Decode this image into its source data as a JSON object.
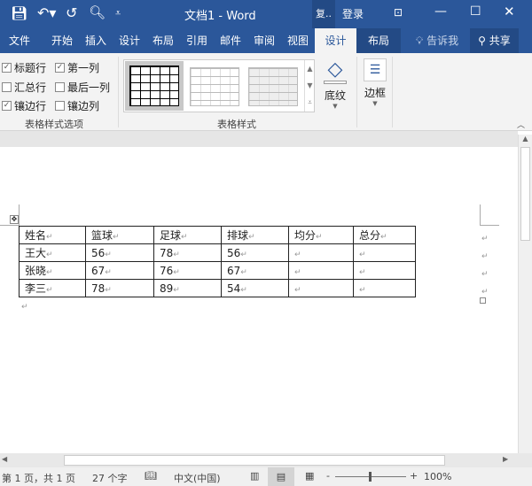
{
  "title": "文档1 - Word",
  "title_ext": "复..",
  "login": "登录",
  "tabs": [
    "文件",
    "开始",
    "插入",
    "设计",
    "布局",
    "引用",
    "邮件",
    "审阅",
    "视图",
    "设计",
    "布局"
  ],
  "tell_me": "告诉我",
  "share": "共享",
  "style_options": {
    "items": [
      {
        "label": "标题行",
        "checked": true
      },
      {
        "label": "第一列",
        "checked": true
      },
      {
        "label": "汇总行",
        "checked": false
      },
      {
        "label": "最后一列",
        "checked": false
      },
      {
        "label": "镶边行",
        "checked": true
      },
      {
        "label": "镶边列",
        "checked": false
      }
    ],
    "group": "表格样式选项"
  },
  "table_styles_group": "表格样式",
  "shading": "底纹",
  "borders": "边框",
  "table": {
    "headers": [
      "姓名",
      "篮球",
      "足球",
      "排球",
      "均分",
      "总分"
    ],
    "rows": [
      [
        "王大",
        "56",
        "78",
        "56",
        "",
        ""
      ],
      [
        "张晓",
        "67",
        "76",
        "67",
        "",
        ""
      ],
      [
        "李三",
        "78",
        "89",
        "54",
        "",
        ""
      ]
    ]
  },
  "status": {
    "page": "第 1 页，共 1 页",
    "words": "27 个字",
    "language": "中文(中国)",
    "zoom": "100%"
  },
  "colors": {
    "brand": "#2b579a"
  }
}
